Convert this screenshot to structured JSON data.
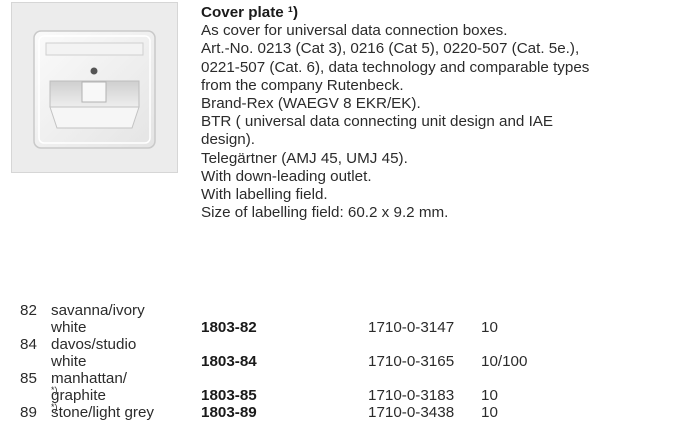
{
  "product": {
    "title": "Cover plate ¹)",
    "description_lines": [
      "As cover for universal data connection boxes.",
      "Art.-No. 0213 (Cat 3), 0216 (Cat 5), 0220-507 (Cat. 5e.),",
      "0221-507 (Cat. 6), data technology and comparable types",
      "from the company Rutenbeck.",
      "Brand-Rex (WAEGV 8 EKR/EK).",
      "BTR ( universal data connecting unit design and IAE",
      "design).",
      "Telegärtner (AMJ 45, UMJ 45).",
      "With down-leading outlet.",
      "With labelling field.",
      "Size of labelling field: 60.2 x 9.2 mm."
    ]
  },
  "variants": [
    {
      "code": "82",
      "desc1": "savanna/ivory",
      "desc2": "white",
      "article": "1803-82",
      "ean": "1710-0-3147",
      "pack": "10"
    },
    {
      "code": "84",
      "desc1": "davos/studio",
      "desc2": "white",
      "article": "1803-84",
      "ean": "1710-0-3165",
      "pack": "10/100"
    },
    {
      "code": "85",
      "desc1": "manhattan/",
      "desc2": "graphite",
      "note2": "*)",
      "article": "1803-85",
      "ean": "1710-0-3183",
      "pack": "10"
    },
    {
      "code": "89",
      "desc1": "stone/light grey",
      "note1": "*)",
      "desc2": "",
      "article": "1803-89",
      "ean": "1710-0-3438",
      "pack": "10"
    }
  ]
}
